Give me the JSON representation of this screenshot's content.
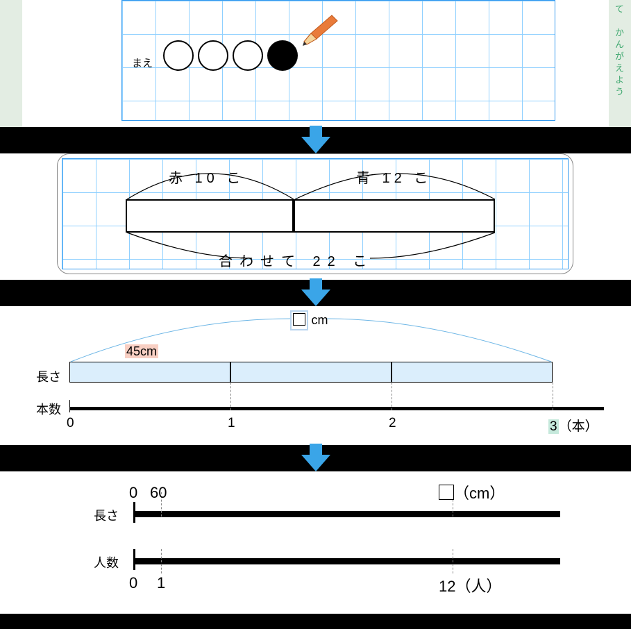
{
  "panel1": {
    "side_text": "て　かんがえよう",
    "mae_label": "まえ"
  },
  "panel2": {
    "red_label": "赤 10 こ",
    "blue_label": "青 12 こ",
    "total_label": "合わせて 22 こ"
  },
  "panel3": {
    "length_axis": "長さ",
    "count_axis": "本数",
    "one_length": "45cm",
    "unknown_unit": "cm",
    "ticks": {
      "t0": "0",
      "t1": "1",
      "t2": "2",
      "t3": "3"
    },
    "unit_suffix": "（本）"
  },
  "panel4": {
    "length_axis": "長さ",
    "people_axis": "人数",
    "top_zero": "0",
    "top_sixty": "60",
    "top_unit": "（cm）",
    "bottom_zero": "0",
    "bottom_one": "1",
    "bottom_twelve": "12",
    "bottom_unit": "（人）"
  }
}
